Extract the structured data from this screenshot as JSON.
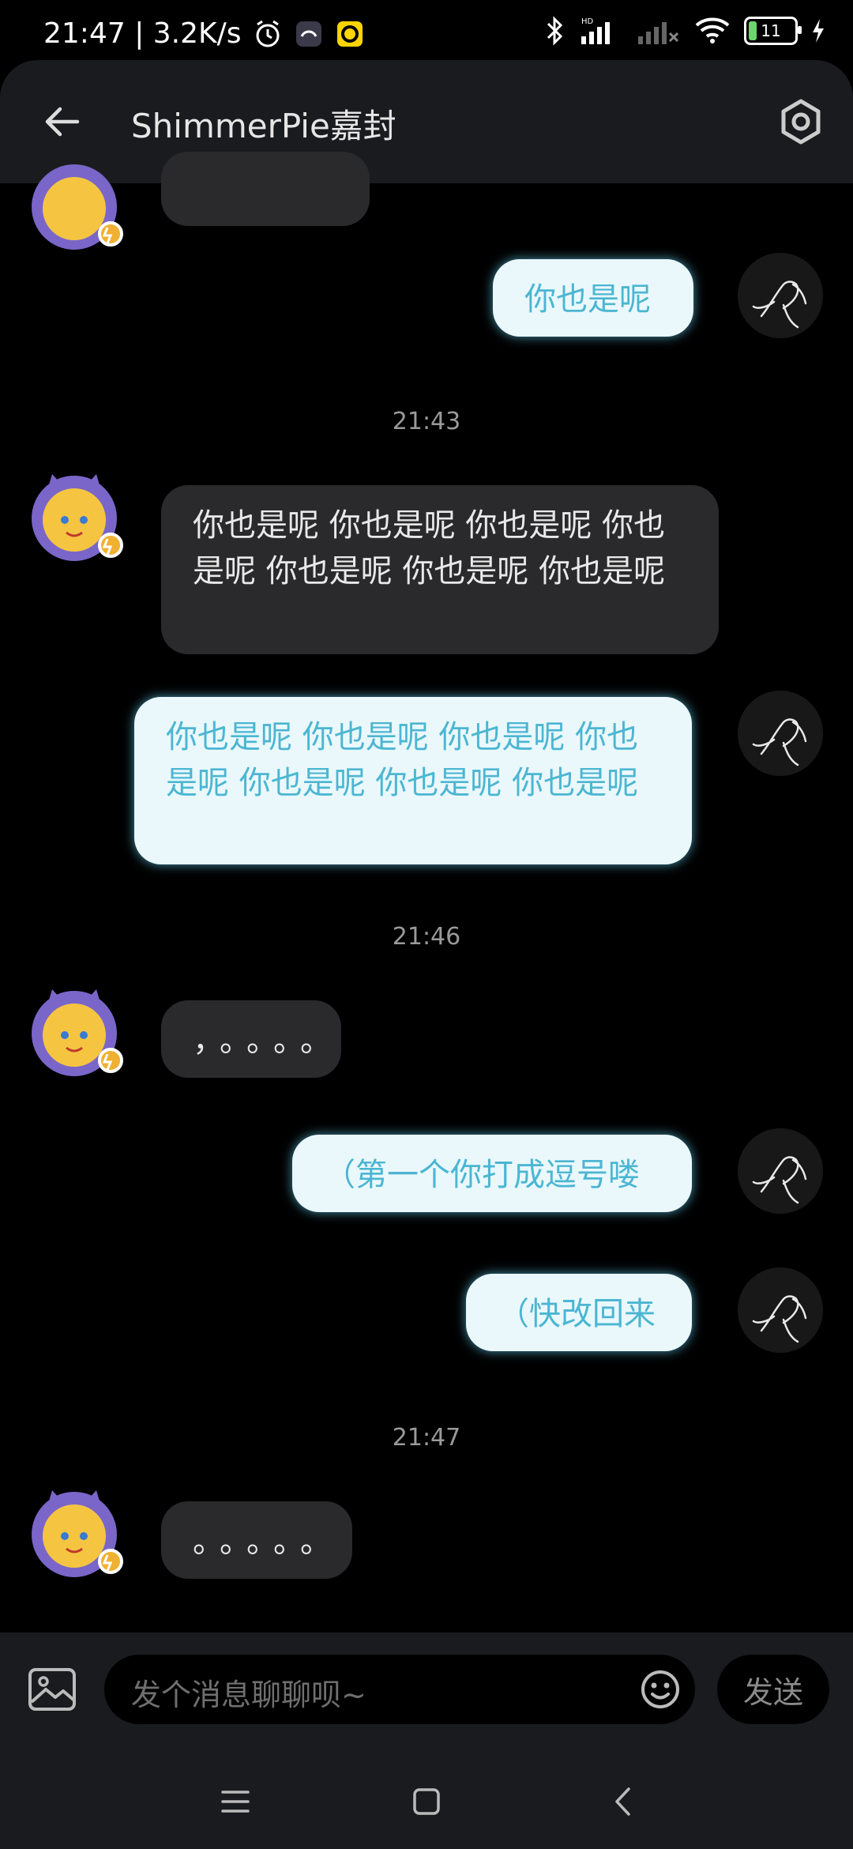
{
  "status_bar": {
    "time_speed": "21:47 | 3.2K/s",
    "battery": "11",
    "icons": [
      "alarm-icon",
      "app-icon",
      "yellow-app-icon",
      "bluetooth-icon",
      "signal-icon",
      "wifi-icon",
      "charging-icon"
    ]
  },
  "header": {
    "title": "ShimmerPie嘉封"
  },
  "timestamps": [
    "21:43",
    "21:46",
    "21:47"
  ],
  "messages": [
    {
      "from": "me",
      "text": "你也是呢"
    },
    {
      "from": "them",
      "text": "你也是呢 你也是呢 你也是呢 你也是呢 你也是呢 你也是呢 你也是呢"
    },
    {
      "from": "me",
      "text": "你也是呢 你也是呢 你也是呢 你也是呢 你也是呢 你也是呢 你也是呢"
    },
    {
      "from": "them",
      "text": "，。。。。"
    },
    {
      "from": "me",
      "text": "（第一个你打成逗号喽"
    },
    {
      "from": "me",
      "text": "（快改回来"
    },
    {
      "from": "them",
      "text": "。。。。。"
    }
  ],
  "input": {
    "placeholder": "发个消息聊聊呗~",
    "send_label": "发送"
  },
  "colors": {
    "accent": "#4cb6d2",
    "my_bubble": "#eaf8fc",
    "their_bubble": "#2a2a2c"
  }
}
